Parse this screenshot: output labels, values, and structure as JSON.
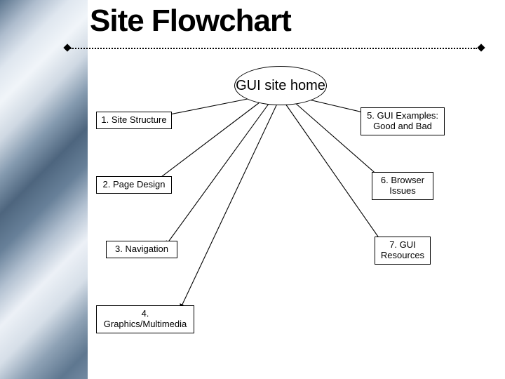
{
  "title": "Site Flowchart",
  "hub": "GUI site home",
  "nodes": {
    "n1": "1. Site Structure",
    "n2": "2. Page Design",
    "n3": "3. Navigation",
    "n4": "4. Graphics/Multimedia",
    "n5": "5. GUI Examples: Good and Bad",
    "n6": "6. Browser Issues",
    "n7": "7. GUI Resources"
  }
}
